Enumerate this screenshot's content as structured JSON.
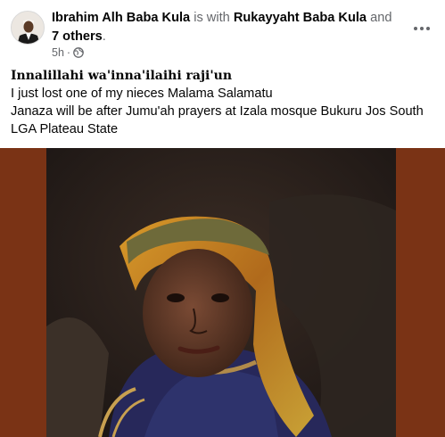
{
  "post": {
    "author": "Ibrahim Alh Baba Kula",
    "with_text": " is with ",
    "tagged": "Rukayyaht Baba Kula",
    "and_text": " and ",
    "others": "7 others",
    "period": ".",
    "time": "5h",
    "dot": "·",
    "audience_icon": "globe-icon",
    "more_icon": "more-options-icon",
    "heading": "Innalillahi wa'inna'ilaihi raji'un",
    "lines": [
      "I just lost one of my nieces Malama Salamatu",
      "Janaza will be after Jumu'ah prayers at Izala mosque Bukuru Jos South",
      "LGA Plateau State"
    ]
  },
  "colors": {
    "photo_frame": "#7a3315",
    "secondary_text": "#65676b"
  }
}
